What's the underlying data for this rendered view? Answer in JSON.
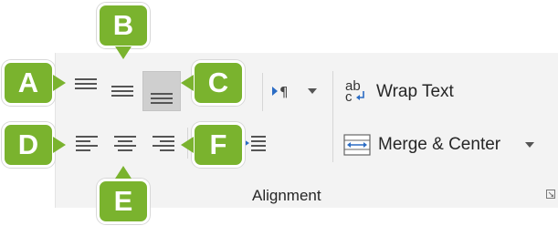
{
  "group": {
    "label": "Alignment"
  },
  "buttons": {
    "wrap_text": "Wrap Text",
    "merge_center": "Merge & Center",
    "wrap_icon_top": "ab",
    "wrap_icon_bottom": "c"
  },
  "callouts": {
    "a": "A",
    "b": "B",
    "c": "C",
    "d": "D",
    "e": "E",
    "f": "F"
  },
  "colors": {
    "callout": "#7ab32e",
    "ribbon": "#f3f3f3",
    "selected": "#cfcfcf",
    "accent": "#2b6cc4"
  }
}
